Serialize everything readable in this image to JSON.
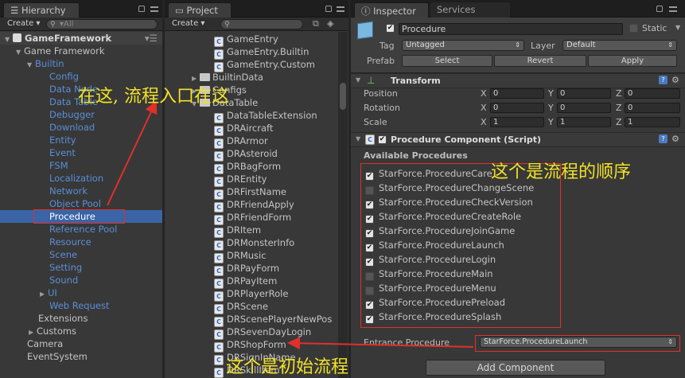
{
  "hierarchy": {
    "tab": "Hierarchy",
    "create": "Create ▾",
    "search_placeholder": "▾All",
    "root": "GameFramework",
    "items": [
      "Game Framework",
      "Builtin",
      "Config",
      "Data Node",
      "Data Table",
      "Debugger",
      "Download",
      "Entity",
      "Event",
      "FSM",
      "Localization",
      "Network",
      "Object Pool",
      "Procedure",
      "Reference Pool",
      "Resource",
      "Scene",
      "Setting",
      "Sound",
      "UI",
      "Web Request",
      "Extensions",
      "Customs",
      "Camera",
      "EventSystem"
    ]
  },
  "project": {
    "tab": "Project",
    "create": "Create ▾",
    "items": [
      "GameEntry",
      "GameEntry.Builtin",
      "GameEntry.Custom",
      "BuiltinData",
      "Configs",
      "DataTable",
      "DataTableExtension",
      "DRAircraft",
      "DRArmor",
      "DRAsteroid",
      "DRBagForm",
      "DREntity",
      "DRFirstName",
      "DRFriendApply",
      "DRFriendForm",
      "DRItem",
      "DRMonsterInfo",
      "DRMusic",
      "DRPayForm",
      "DRPayItem",
      "DRPlayerRole",
      "DRScene",
      "DRScenePlayerNewPos",
      "DRSevenDayLogin",
      "DRShopForm",
      "DRSignInName",
      "DRSkillItem"
    ]
  },
  "inspector": {
    "tabs": [
      "Inspector",
      "Services"
    ],
    "object_name": "Procedure",
    "static_label": "Static",
    "tag_label": "Tag",
    "tag_value": "Untagged",
    "layer_label": "Layer",
    "layer_value": "Default",
    "prefab_label": "Prefab",
    "prefab_buttons": [
      "Select",
      "Revert",
      "Apply"
    ],
    "transform": {
      "title": "Transform",
      "rows": [
        {
          "label": "Position",
          "x": "0",
          "y": "0",
          "z": "0"
        },
        {
          "label": "Rotation",
          "x": "0",
          "y": "0",
          "z": "0"
        },
        {
          "label": "Scale",
          "x": "1",
          "y": "1",
          "z": "1"
        }
      ],
      "axis": [
        "X",
        "Y",
        "Z"
      ]
    },
    "component_title": "Procedure Component (Script)",
    "available_label": "Available Procedures",
    "procedures": [
      {
        "name": "StarForce.ProcedureCare",
        "checked": true
      },
      {
        "name": "StarForce.ProcedureChangeScene",
        "checked": false
      },
      {
        "name": "StarForce.ProcedureCheckVersion",
        "checked": true
      },
      {
        "name": "StarForce.ProcedureCreateRole",
        "checked": true
      },
      {
        "name": "StarForce.ProcedureJoinGame",
        "checked": true
      },
      {
        "name": "StarForce.ProcedureLaunch",
        "checked": true
      },
      {
        "name": "StarForce.ProcedureLogin",
        "checked": true
      },
      {
        "name": "StarForce.ProcedureMain",
        "checked": false
      },
      {
        "name": "StarForce.ProcedureMenu",
        "checked": false
      },
      {
        "name": "StarForce.ProcedurePreload",
        "checked": true
      },
      {
        "name": "StarForce.ProcedureSplash",
        "checked": true
      }
    ],
    "entrance_label": "Entrance Procedure",
    "entrance_value": "StarForce.ProcedureLaunch",
    "add_component": "Add Component"
  },
  "annotations": {
    "entry": "在这, 流程入口在这",
    "order": "这个是流程的顺序",
    "initial": "这个是初始流程"
  },
  "colors": {
    "annotation": "#f2e226",
    "highlight": "#e0302a",
    "selection": "#3a64a6",
    "link_blue": "#5a8fd6"
  }
}
